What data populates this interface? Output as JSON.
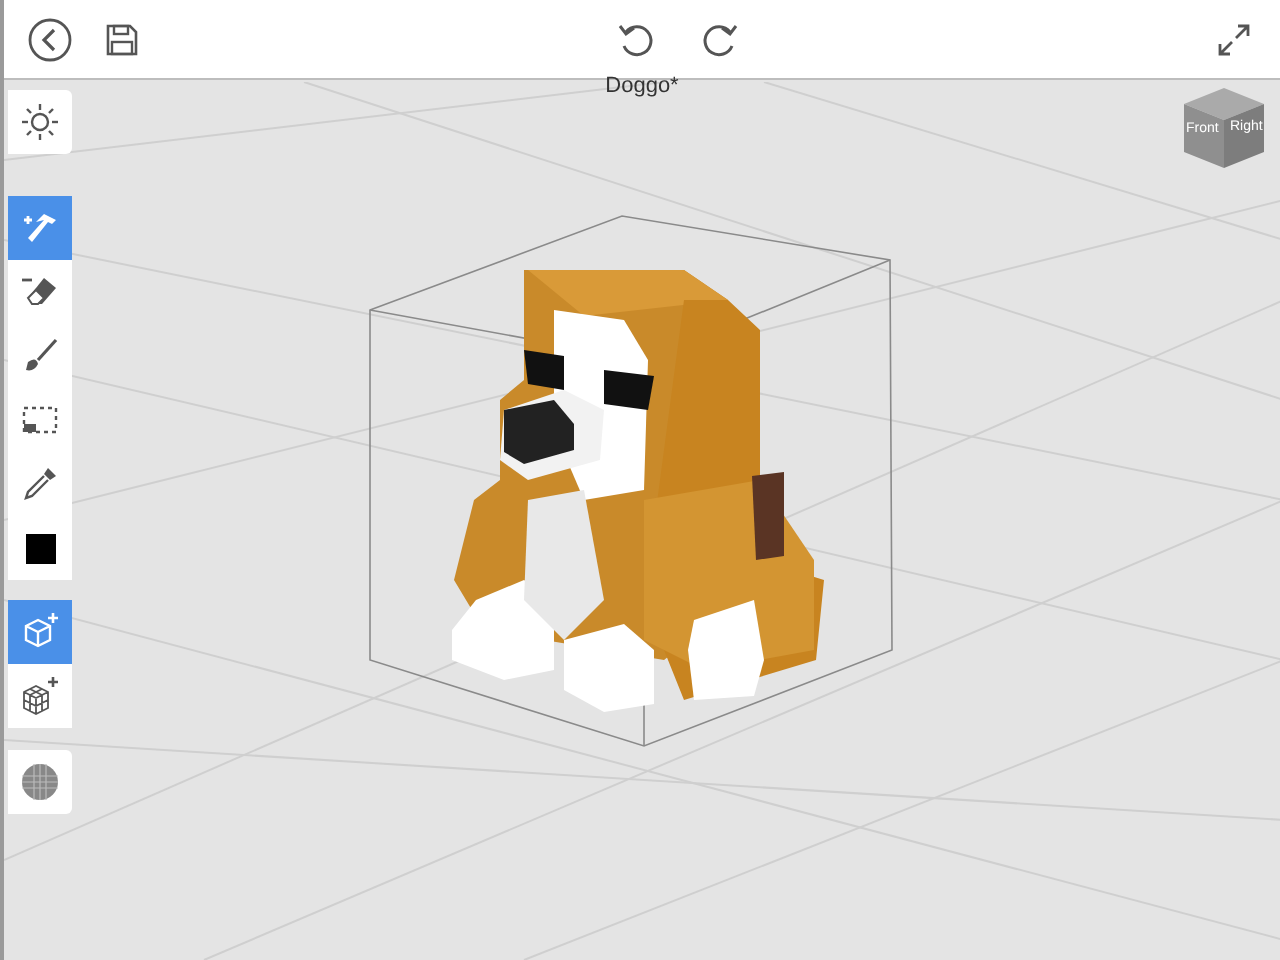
{
  "document": {
    "title": "Doggo*"
  },
  "view_cube": {
    "faces": [
      "Front",
      "Right"
    ]
  },
  "tools": [
    {
      "kind": "build",
      "selected": true
    },
    {
      "kind": "erase",
      "selected": false
    },
    {
      "kind": "paint",
      "selected": false
    },
    {
      "kind": "select",
      "selected": false
    },
    {
      "kind": "picker",
      "selected": false
    },
    {
      "kind": "color",
      "selected": false,
      "color": "#000000"
    }
  ],
  "modes": [
    {
      "kind": "single",
      "selected": true
    },
    {
      "kind": "multi",
      "selected": false
    }
  ]
}
